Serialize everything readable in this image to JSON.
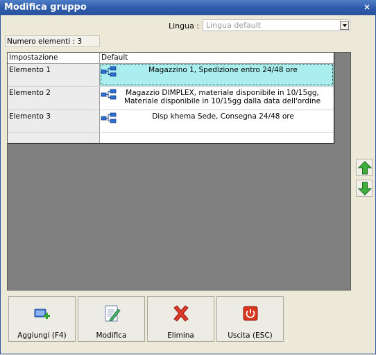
{
  "window": {
    "title": "Modifica gruppo",
    "close_symbol": "×"
  },
  "language": {
    "label": "Lingua :",
    "value": "Lingua default"
  },
  "count_label": "Numero elementi : 3",
  "grid": {
    "headers": [
      "Impostazione",
      "Default"
    ],
    "rows": [
      {
        "name": "Elemento 1",
        "line1": "Magazzino 1, Spedizione entro 24/48 ore",
        "line2": ""
      },
      {
        "name": "Elemento 2",
        "line1": "Magazzio DIMPLEX, materiale disponibile in 10/15gg,",
        "line2": "Materiale disponibile in 10/15gg dalla data dell'ordine"
      },
      {
        "name": "Elemento 3",
        "line1": "Disp khema Sede, Consegna 24/48 ore",
        "line2": ""
      }
    ],
    "selected_row": 0
  },
  "buttons": {
    "add": "Aggiungi (F4)",
    "edit": "Modifica",
    "delete": "Elimina",
    "exit": "Uscita (ESC)"
  },
  "colors": {
    "titlebar": "#2d5aa9",
    "selected_row": "#aaeef0",
    "arrow_green": "#3fae3f",
    "delete_red": "#e03a2a"
  },
  "icons": {
    "row": "network-tree-icon",
    "move_up": "arrow-up-icon",
    "move_down": "arrow-down-icon",
    "add": "add-icon",
    "edit": "edit-document-icon",
    "delete": "delete-x-icon",
    "exit": "power-icon"
  }
}
